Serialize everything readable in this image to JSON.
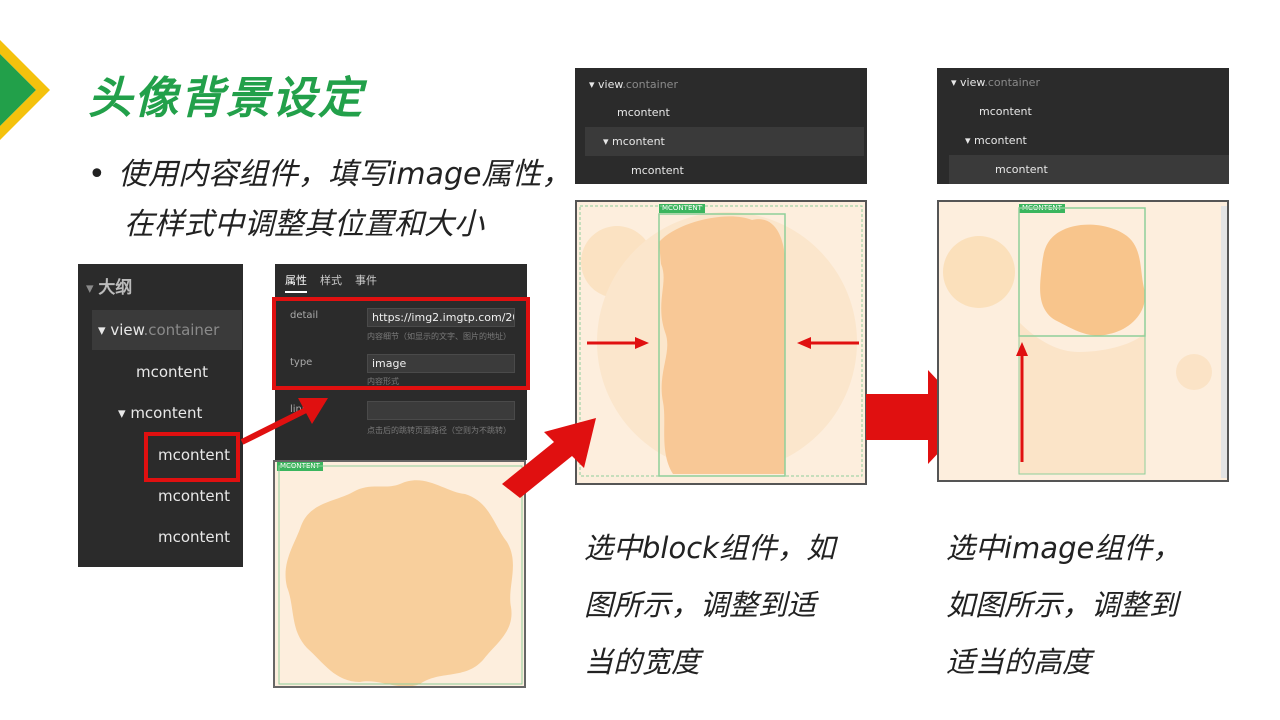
{
  "title": "头像背景设定",
  "bullet": {
    "line1": "使用内容组件，填写image属性，",
    "line2": "在样式中调整其位置和大小"
  },
  "outline": {
    "header": "大纲",
    "view_label": "view",
    "view_class": ".container",
    "items": [
      "mcontent",
      "mcontent",
      "mcontent",
      "mcontent",
      "mcontent"
    ]
  },
  "props_panel": {
    "tabs": [
      "属性",
      "样式",
      "事件"
    ],
    "detail_label": "detail",
    "detail_value": "https://img2.imgtp.com/2024/",
    "detail_hint": "内容细节（如显示的文字、图片的地址）",
    "type_label": "type",
    "type_value": "image",
    "type_hint": "内容形式",
    "link_label": "link",
    "link_value": "",
    "link_hint": "点击后的跳转页面路径（空则为不跳转）"
  },
  "preview_tag": "MCONTENT",
  "tree_mid": {
    "view_label": "view",
    "view_class": ".container",
    "items": [
      "mcontent",
      "mcontent",
      "mcontent"
    ]
  },
  "tree_right": {
    "view_label": "view",
    "view_class": ".container",
    "items": [
      "mcontent",
      "mcontent",
      "mcontent"
    ]
  },
  "caption_mid": [
    "选中block组件，如",
    "图所示，调整到适",
    "当的宽度"
  ],
  "caption_right": [
    "选中image组件，",
    "如图所示，调整到",
    "适当的高度"
  ],
  "colors": {
    "accent_green": "#22a04a",
    "arrow_red": "#e01010",
    "panel_dark": "#2b2b2b",
    "shape_peach": "#f8cf9c",
    "bg_peach": "#fdeedd",
    "selection_green": "#8fcf9a"
  }
}
